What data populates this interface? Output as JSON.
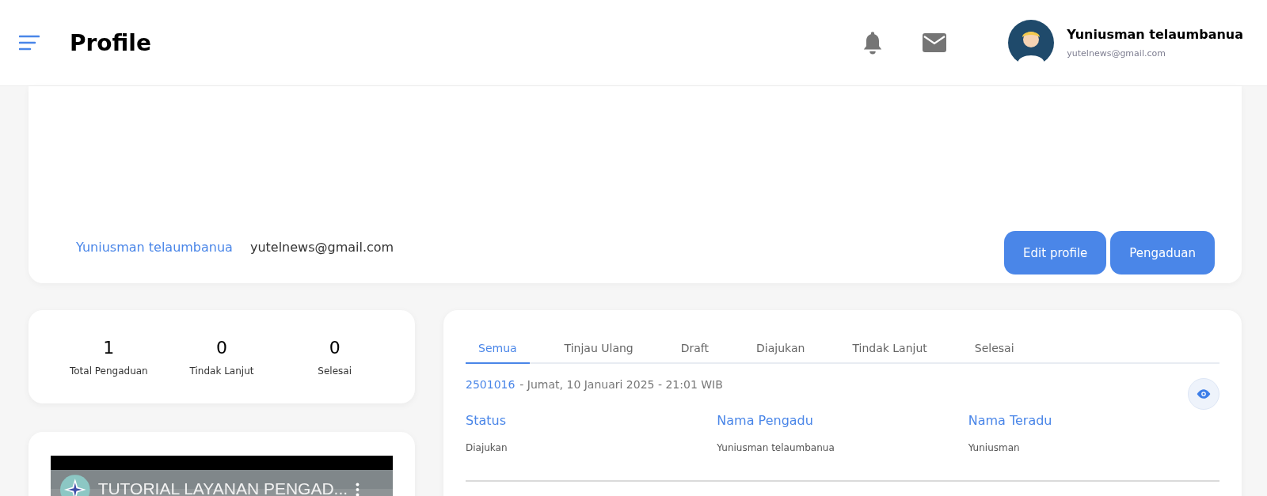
{
  "header": {
    "title": "Profile",
    "user_name": "Yuniusman telaumbanua",
    "user_email": "yutelnews@gmail.com"
  },
  "profile": {
    "name": "Yuniusman telaumbanua",
    "email": "yutelnews@gmail.com",
    "buttons": [
      "Edit profile",
      "Pengaduan"
    ]
  },
  "stats": [
    {
      "value": "1",
      "label": "Total Pengaduan"
    },
    {
      "value": "0",
      "label": "Tindak Lanjut"
    },
    {
      "value": "0",
      "label": "Selesai"
    }
  ],
  "video": {
    "title": "TUTORIAL LAYANAN PENGAD..."
  },
  "tabs": [
    {
      "label": "Semua",
      "selected": true
    },
    {
      "label": "Tinjau Ulang",
      "selected": false
    },
    {
      "label": "Draft",
      "selected": false
    },
    {
      "label": "Diajukan",
      "selected": false
    },
    {
      "label": "Tindak Lanjut",
      "selected": false
    },
    {
      "label": "Selesai",
      "selected": false
    }
  ],
  "complaints": [
    {
      "id": "2501016",
      "date": "- Jumat, 10 Januari 2025 - 21:01 WIB",
      "fields": [
        {
          "label": "Status",
          "value": "Diajukan"
        },
        {
          "label": "Nama Pengadu",
          "value": "Yuniusman telaumbanua"
        },
        {
          "label": "Nama Teradu",
          "value": "Yuniusman"
        }
      ]
    }
  ]
}
